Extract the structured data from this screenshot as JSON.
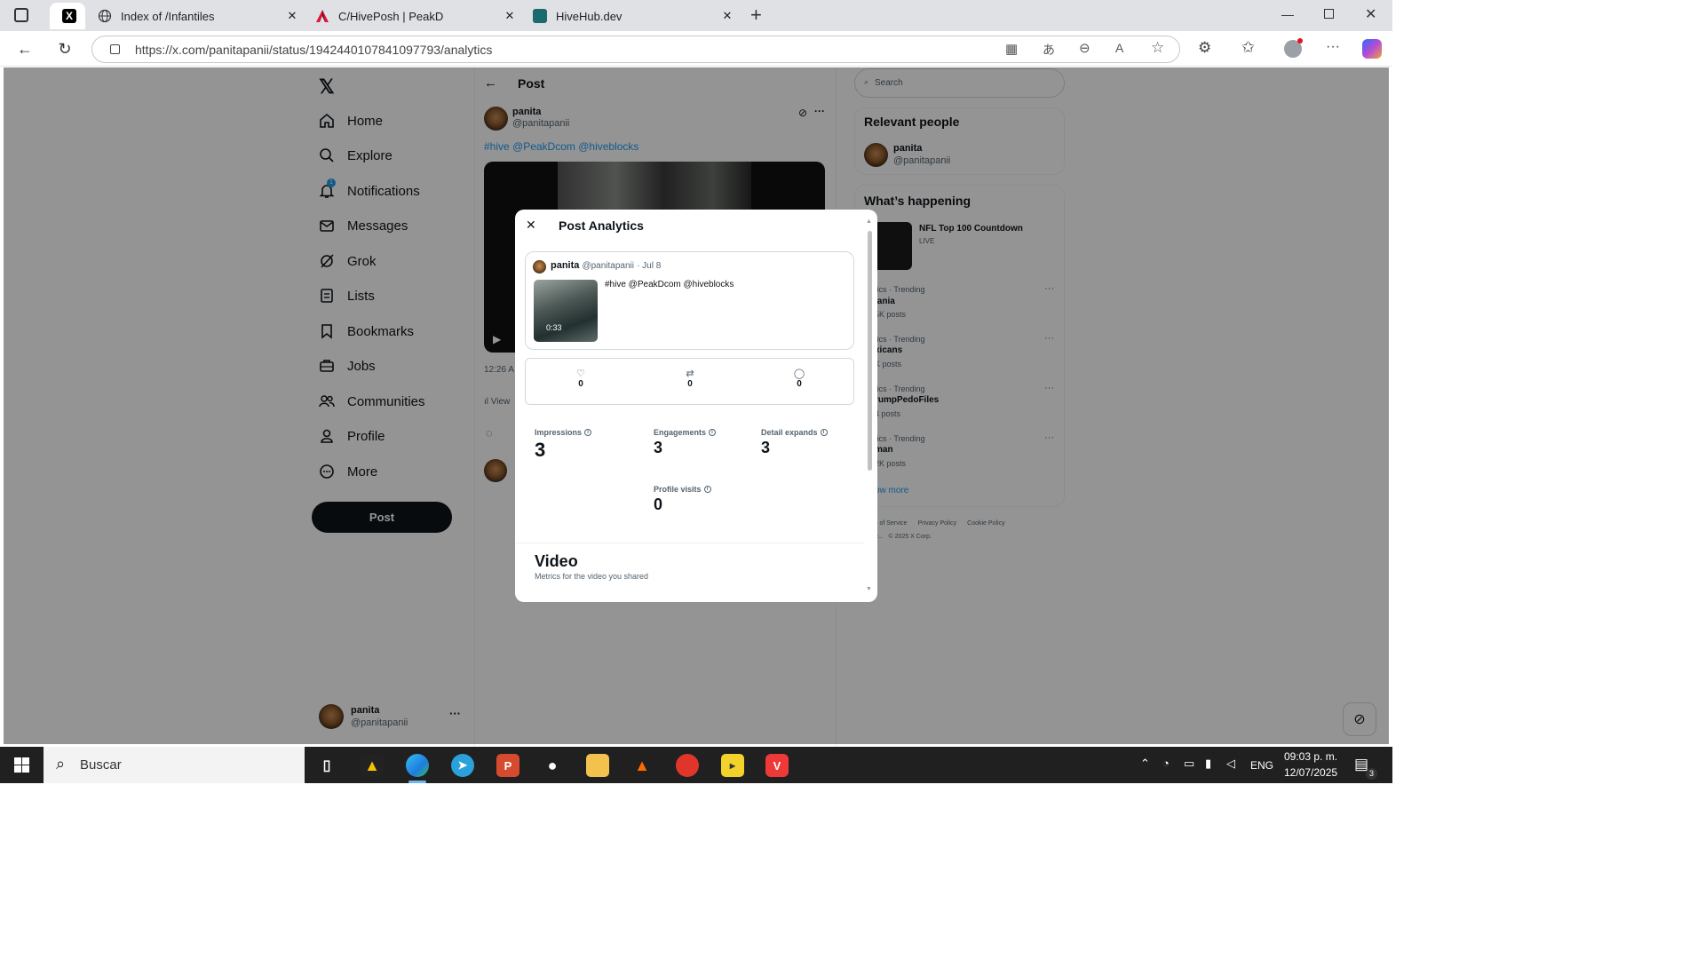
{
  "browser": {
    "tabs": [
      {
        "title": "",
        "icon": "x-logo"
      },
      {
        "title": "Index of /Infantiles",
        "icon": "globe-icon"
      },
      {
        "title": "C/HivePosh | PeakD",
        "icon": "peakd-icon"
      },
      {
        "title": "HiveHub.dev",
        "icon": "hivehub-icon"
      }
    ],
    "url": "https://x.com/panitapanii/status/1942440107841097793/analytics"
  },
  "sidebar": {
    "items": [
      {
        "label": "Home",
        "icon": "home-icon"
      },
      {
        "label": "Explore",
        "icon": "search-icon"
      },
      {
        "label": "Notifications",
        "icon": "bell-icon",
        "badge": "1"
      },
      {
        "label": "Messages",
        "icon": "mail-icon"
      },
      {
        "label": "Grok",
        "icon": "grok-icon"
      },
      {
        "label": "Lists",
        "icon": "list-icon"
      },
      {
        "label": "Bookmarks",
        "icon": "bookmark-icon"
      },
      {
        "label": "Jobs",
        "icon": "briefcase-icon"
      },
      {
        "label": "Communities",
        "icon": "people-icon"
      },
      {
        "label": "Profile",
        "icon": "person-icon"
      },
      {
        "label": "More",
        "icon": "more-circle-icon"
      }
    ],
    "post_button": "Post",
    "account": {
      "name": "panita",
      "handle": "@panitapanii",
      "more": "···"
    }
  },
  "main": {
    "header": "Post",
    "author": {
      "name": "panita",
      "handle": "@panitapanii"
    },
    "text": "#hive @PeakDcom @hiveblocks",
    "timestamp": "12:26 A",
    "views_label": "View"
  },
  "right": {
    "search_placeholder": "Search",
    "relevant_title": "Relevant people",
    "relevant_person": {
      "name": "panita",
      "handle": "@panitapanii"
    },
    "happening_title": "What’s happening",
    "live_event": {
      "title": "NFL Top 100 Countdown",
      "status": "LIVE"
    },
    "trends": [
      {
        "category": "tics · Trending",
        "name": "lania",
        "posts": "5K posts"
      },
      {
        "category": "tics · Trending",
        "name": "xicans",
        "posts": "K posts"
      },
      {
        "category": "tics · Trending",
        "name": "rumpPedoFiles",
        "posts": "4 posts"
      },
      {
        "category": "tics · Trending",
        "name": "man",
        "posts": "2K posts"
      }
    ],
    "show_more": "ow more",
    "footer_links": [
      "s of Service",
      "Privacy Policy",
      "Cookie Policy"
    ],
    "footer_copy": "e...   © 2025 X Corp."
  },
  "modal": {
    "title": "Post Analytics",
    "post": {
      "name": "panita",
      "handle": "@panitapanii",
      "date": "· Jul 8",
      "text": "#hive @PeakDcom @hiveblocks",
      "duration": "0:33"
    },
    "stats": [
      {
        "icon": "heart-icon",
        "value": "0"
      },
      {
        "icon": "retweet-icon",
        "value": "0"
      },
      {
        "icon": "reply-icon",
        "value": "0"
      }
    ],
    "metrics": {
      "impressions": {
        "label": "Impressions",
        "value": "3"
      },
      "engagements": {
        "label": "Engagements",
        "value": "3"
      },
      "detail_expands": {
        "label": "Detail expands",
        "value": "3"
      },
      "profile_visits": {
        "label": "Profile visits",
        "value": "0"
      }
    },
    "video": {
      "title": "Video",
      "subtitle": "Metrics for the video you shared"
    }
  },
  "taskbar": {
    "search_placeholder": "Buscar",
    "lang": "ENG",
    "time": "09:03 p. m.",
    "date": "12/07/2025",
    "notif_count": "3"
  }
}
